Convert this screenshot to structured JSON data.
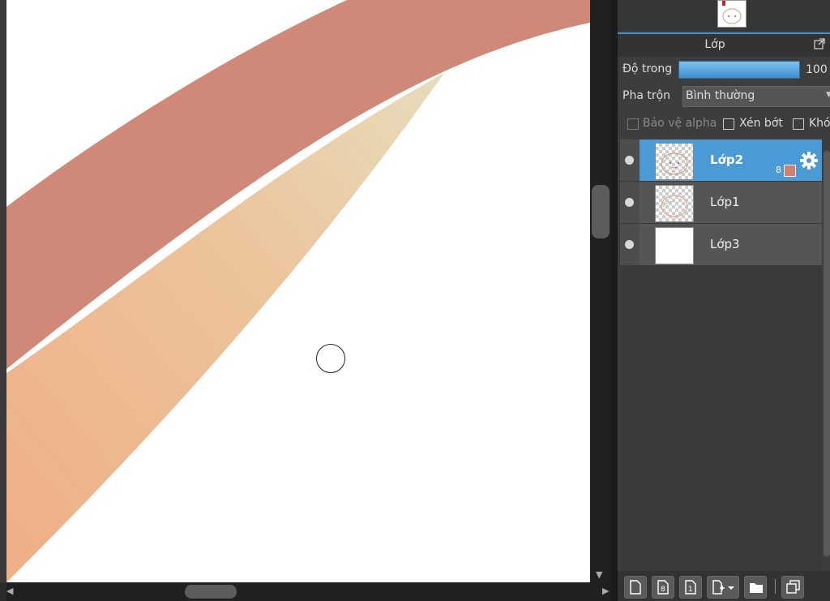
{
  "panel": {
    "title": "Lớp",
    "opacity_label": "Độ trong",
    "opacity_value": "100 %",
    "opacity": 100,
    "blend_label": "Pha trộn",
    "blend_value": "Bình thường",
    "checkboxes": [
      {
        "label": "Bảo vệ alpha",
        "checked": false,
        "disabled": true
      },
      {
        "label": "Xén bớt",
        "checked": false,
        "disabled": false
      },
      {
        "label": "Khóa",
        "checked": false,
        "disabled": false
      }
    ]
  },
  "layers": [
    {
      "name": "Lớp2",
      "selected": true,
      "badge": "8",
      "color": "#d08070"
    },
    {
      "name": "Lớp1",
      "selected": false
    },
    {
      "name": "Lớp3",
      "selected": false
    }
  ],
  "colors": {
    "accent": "#4a9ad6",
    "stroke_red": "#d08878",
    "stroke_peach": "#ecb48a"
  },
  "icons": [
    "popout-icon",
    "eye-icon",
    "gear-icon",
    "new-layer-icon",
    "new-8bit-layer-icon",
    "new-1bit-layer-icon",
    "add-layer-menu-icon",
    "folder-icon",
    "duplicate-layer-icon"
  ]
}
